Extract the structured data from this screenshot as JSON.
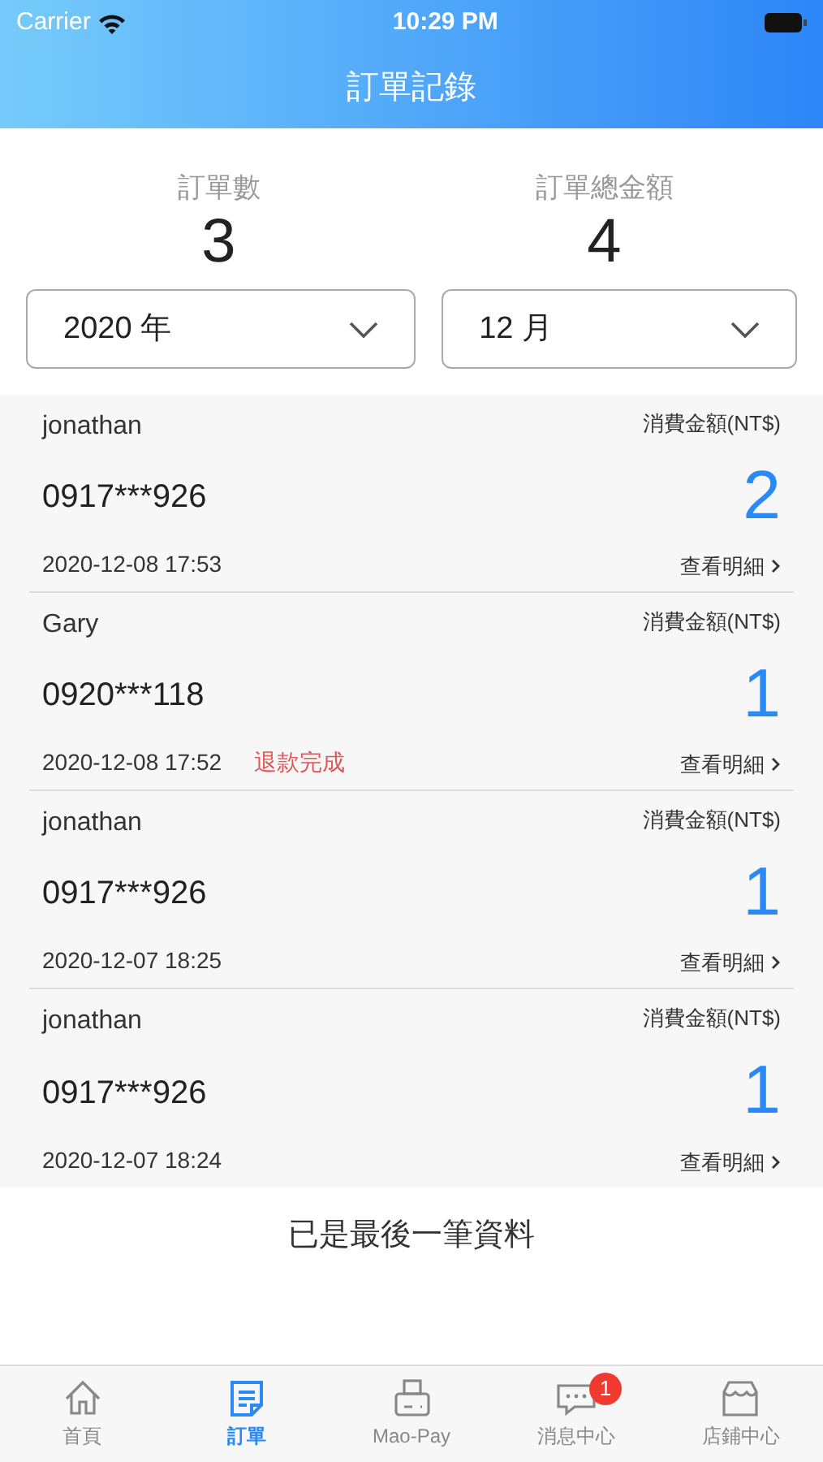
{
  "status_bar": {
    "carrier": "Carrier",
    "time": "10:29 PM"
  },
  "title": "訂單記錄",
  "summary": [
    {
      "label": "訂單數",
      "value": "3"
    },
    {
      "label": "訂單總金額",
      "value": "4"
    }
  ],
  "filters": [
    {
      "value": "2020 年"
    },
    {
      "value": "12 月"
    }
  ],
  "orders": [
    {
      "name": "jonathan",
      "phone": "0917***926",
      "time": "2020-12-08 17:53",
      "amount_label": "消費金額(NT$)",
      "amount": "2",
      "details": "查看明細"
    },
    {
      "name": "Gary",
      "phone": "0920***118",
      "time": "2020-12-08 17:52",
      "status": "退款完成",
      "amount_label": "消費金額(NT$)",
      "amount": "1",
      "details": "查看明細"
    },
    {
      "name": "jonathan",
      "phone": "0917***926",
      "time": "2020-12-07 18:25",
      "amount_label": "消費金額(NT$)",
      "amount": "1",
      "details": "查看明細"
    },
    {
      "name": "jonathan",
      "phone": "0917***926",
      "time": "2020-12-07 18:24",
      "amount_label": "消費金額(NT$)",
      "amount": "1",
      "details": "查看明細"
    }
  ],
  "end_note": "已是最後一筆資料",
  "tabs": [
    {
      "label": "首頁",
      "selected": false
    },
    {
      "label": "訂單",
      "selected": true
    },
    {
      "label": "Mao-Pay",
      "selected": false
    },
    {
      "label": "消息中心",
      "selected": false,
      "badge": "1"
    },
    {
      "label": "店鋪中心",
      "selected": false
    }
  ]
}
